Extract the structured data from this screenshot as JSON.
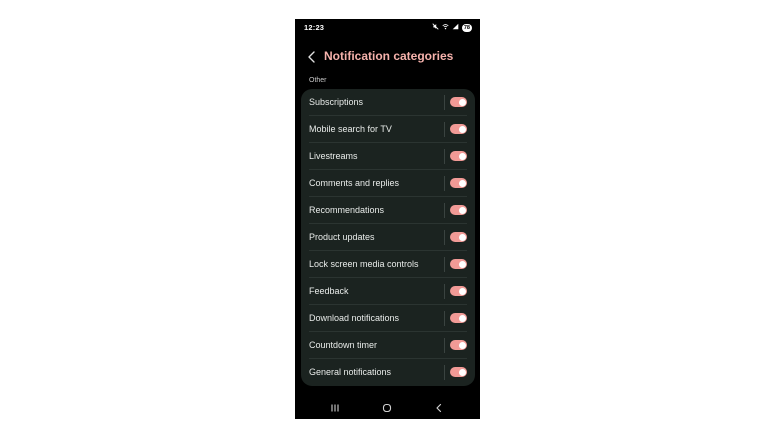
{
  "status_bar": {
    "time": "12:23",
    "icons": [
      "mute-icon",
      "wifi-icon",
      "signal-icon"
    ],
    "battery": "78"
  },
  "header": {
    "back_icon": "chevron-left-icon",
    "title": "Notification categories"
  },
  "section": {
    "label": "Other"
  },
  "items": [
    {
      "label": "Subscriptions",
      "enabled": true
    },
    {
      "label": "Mobile search for TV",
      "enabled": true
    },
    {
      "label": "Livestreams",
      "enabled": true
    },
    {
      "label": "Comments and replies",
      "enabled": true
    },
    {
      "label": "Recommendations",
      "enabled": true
    },
    {
      "label": "Product updates",
      "enabled": true
    },
    {
      "label": "Lock screen media controls",
      "enabled": true
    },
    {
      "label": "Feedback",
      "enabled": true
    },
    {
      "label": "Download notifications",
      "enabled": true
    },
    {
      "label": "Countdown timer",
      "enabled": true
    },
    {
      "label": "General notifications",
      "enabled": true
    }
  ],
  "navigation": {
    "recents_icon": "recents-icon",
    "home_icon": "home-icon",
    "back_icon": "back-icon"
  },
  "colors": {
    "accent": "#f6b2ac",
    "toggle_on": "#f19a96",
    "card_bg": "#1b2320",
    "screen_bg": "#000000"
  }
}
